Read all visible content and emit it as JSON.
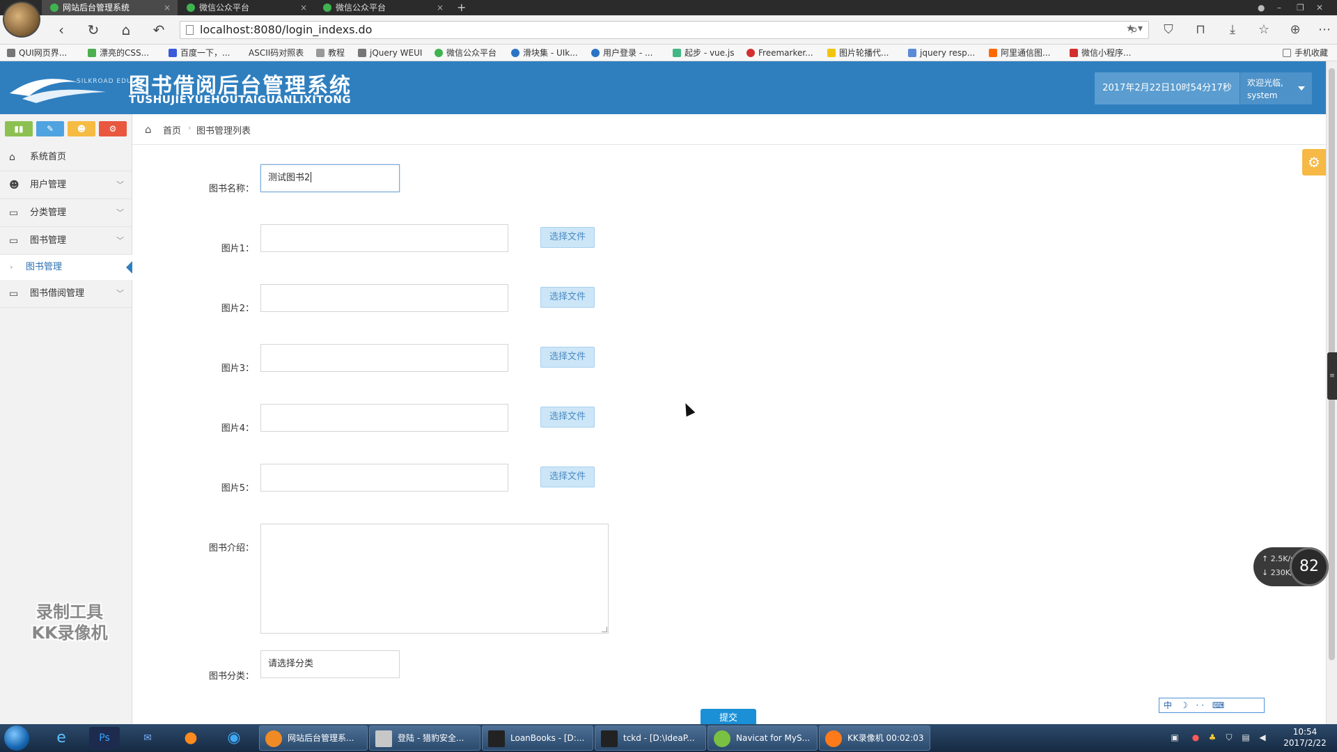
{
  "browser": {
    "tabs": [
      {
        "label": "网站后台管理系统",
        "active": true
      },
      {
        "label": "微信公众平台",
        "active": false
      },
      {
        "label": "微信公众平台",
        "active": false
      }
    ],
    "new_tab_symbol": "+",
    "close_symbol": "×",
    "url": "localhost:8080/login_indexs.do",
    "bookmarks": [
      {
        "label": "QUI网页界...",
        "color": "#777777"
      },
      {
        "label": "漂亮的CSS...",
        "color": "#4caf50"
      },
      {
        "label": "百度一下，...",
        "color": "#3b5bdb"
      },
      {
        "label": "ASCII码对照表",
        "color": ""
      },
      {
        "label": "教程",
        "color": "#777777"
      },
      {
        "label": "jQuery WEUI",
        "color": "#777777"
      },
      {
        "label": "微信公众平台",
        "color": "#3fb34f"
      },
      {
        "label": "滑块集 - UIk...",
        "color": "#2b73c4"
      },
      {
        "label": "用户登录 - ...",
        "color": "#2b73c4"
      },
      {
        "label": "起步 - vue.js",
        "color": "#41b883"
      },
      {
        "label": "Freemarker...",
        "color": "#d32f2f"
      },
      {
        "label": "图片轮播代...",
        "color": "#f1c40f"
      },
      {
        "label": "jquery resp...",
        "color": "#5b8bd6"
      },
      {
        "label": "阿里通信图...",
        "color": "#ff6a00"
      },
      {
        "label": "微信小程序...",
        "color": "#d32f2f"
      },
      {
        "label": "手机收藏",
        "color": ""
      }
    ]
  },
  "app": {
    "logo_small": "SILKROAD EDU",
    "title": "图书借阅后台管理系统",
    "title_pinyin": "TUSHUJIEYUEHOUTAIGUANLIXITONG",
    "datetime": "2017年2月22日10时54分17秒",
    "welcome": "欢迎光临,",
    "username": "system"
  },
  "sidebar": {
    "shortcut_colors": [
      "#8cc152",
      "#4fa3e0",
      "#f6bb42",
      "#e9573f"
    ],
    "items": [
      {
        "label": "系统首页",
        "icon": "home-icon",
        "glyph": "⌂"
      },
      {
        "label": "用户管理",
        "icon": "users-icon",
        "glyph": "☻"
      },
      {
        "label": "分类管理",
        "icon": "monitor-icon",
        "glyph": "▭"
      },
      {
        "label": "图书管理",
        "icon": "monitor-icon",
        "glyph": "▭"
      },
      {
        "label": "图书借阅管理",
        "icon": "monitor-icon",
        "glyph": "▭"
      }
    ],
    "sub_item": "图书管理",
    "watermark_line1": "录制工具",
    "watermark_line2": "KK录像机"
  },
  "breadcrumb": {
    "home": "首页",
    "current": "图书管理列表"
  },
  "form": {
    "name_label": "图书名称：",
    "name_value": "测试图书2",
    "image_labels": [
      "图片1：",
      "图片2：",
      "图片3：",
      "图片4：",
      "图片5："
    ],
    "choose_file": "选择文件",
    "intro_label": "图书介绍：",
    "category_label": "图书分类：",
    "category_value": "请选择分类",
    "submit": "提交"
  },
  "widgets": {
    "speed_up": "↑ 2.5K/s",
    "speed_down": "↓ 230K/s",
    "speed_percent": "82",
    "ime_text": "中 ☽ ·· ⌨"
  },
  "taskbar": {
    "tasks": [
      {
        "label": "网站后台管理系...",
        "color": "#f08a24"
      },
      {
        "label": "登陆 - 猎豹安全...",
        "color": "#c7c7c7"
      },
      {
        "label": "LoanBooks - [D:...",
        "color": "#222222"
      },
      {
        "label": "tckd - [D:\\IdeaP...",
        "color": "#222222"
      },
      {
        "label": "Navicat for MyS...",
        "color": "#7ac043"
      },
      {
        "label": "KK录像机 00:02:03",
        "color": "#ff7a1a"
      }
    ],
    "time": "10:54",
    "date": "2017/2/22"
  }
}
